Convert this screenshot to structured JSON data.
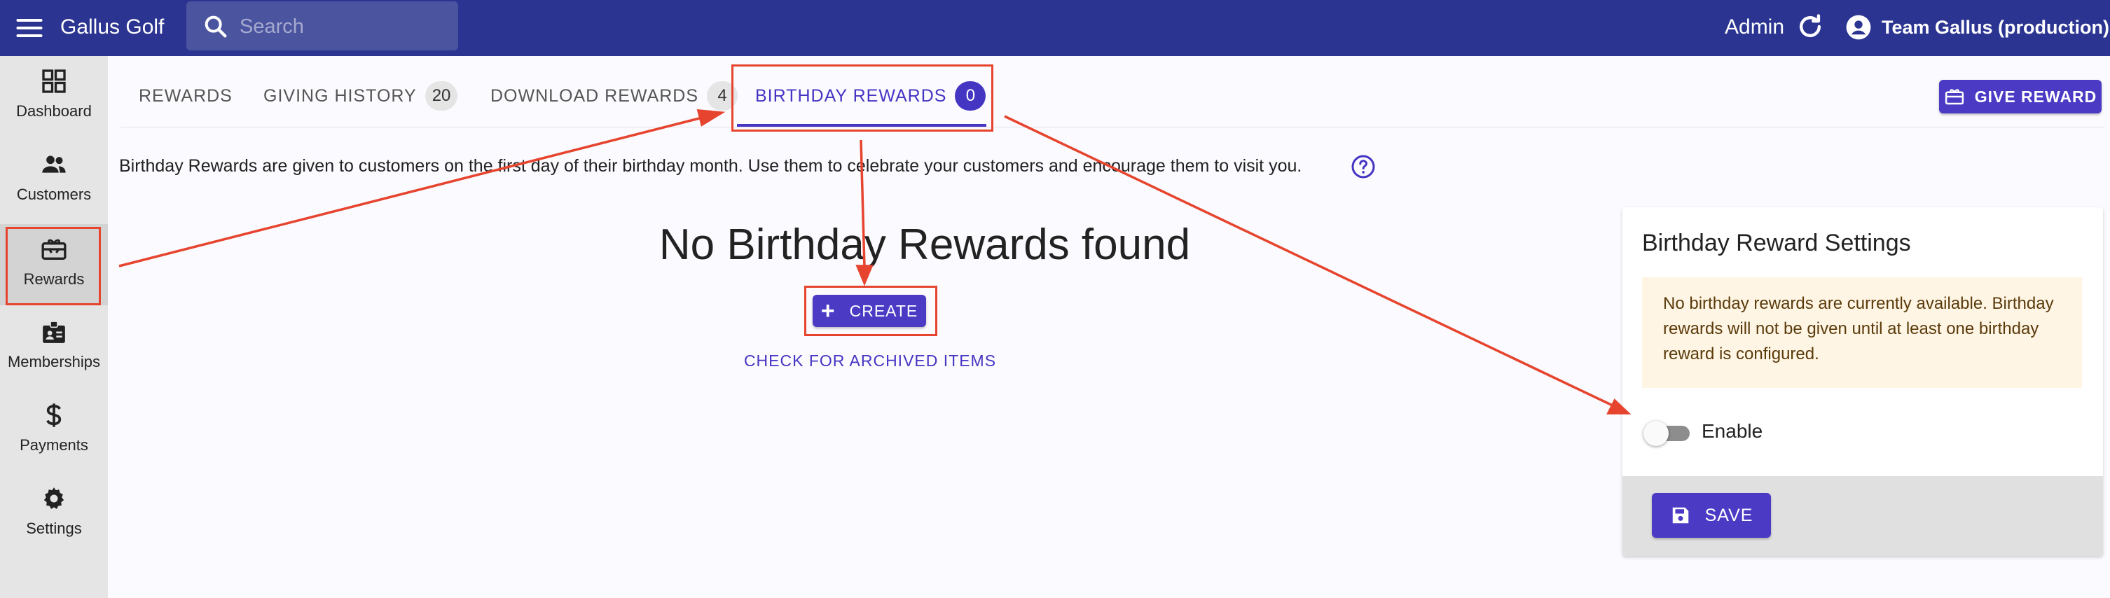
{
  "topbar": {
    "app_title": "Gallus Golf",
    "search_placeholder": "Search",
    "admin_label": "Admin",
    "account_name": "Team Gallus (production)"
  },
  "sidebar": {
    "items": [
      {
        "label": "Dashboard",
        "icon": "dashboard-icon"
      },
      {
        "label": "Customers",
        "icon": "people-icon"
      },
      {
        "label": "Rewards",
        "icon": "gift-card-icon",
        "active": true
      },
      {
        "label": "Memberships",
        "icon": "membership-badge-icon"
      },
      {
        "label": "Payments",
        "icon": "dollar-icon"
      },
      {
        "label": "Settings",
        "icon": "gear-icon"
      }
    ]
  },
  "tabs": [
    {
      "label": "REWARDS"
    },
    {
      "label": "GIVING HISTORY",
      "count": "20"
    },
    {
      "label": "DOWNLOAD REWARDS",
      "count": "4"
    },
    {
      "label": "BIRTHDAY REWARDS",
      "count": "0",
      "active": true
    }
  ],
  "give_reward_label": "GIVE REWARD",
  "description": "Birthday Rewards are given to customers on the first day of their birthday month. Use them to celebrate your customers and encourage them to visit you.",
  "empty_state": {
    "title": "No Birthday Rewards found",
    "create_label": "CREATE",
    "archived_link": "CHECK FOR ARCHIVED ITEMS"
  },
  "settings_card": {
    "title": "Birthday Reward Settings",
    "warning": "No birthday rewards are currently available. Birthday rewards will not be given until at least one birthday reward is configured.",
    "enable_label": "Enable",
    "enabled": false,
    "save_label": "SAVE"
  },
  "colors": {
    "topbar": "#2b3591",
    "accent": "#4535c3",
    "annotation": "#e6442e",
    "warning_bg": "#fff5e5"
  }
}
